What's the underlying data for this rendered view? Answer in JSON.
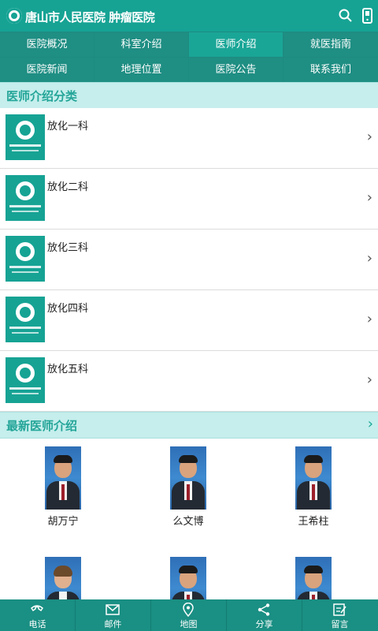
{
  "header": {
    "brand": "唐山市人民医院 肿瘤医院"
  },
  "icons": {
    "search": "search-icon",
    "phone": "mobile-phone-icon"
  },
  "nav": {
    "items": [
      {
        "label": "医院概况",
        "active": false
      },
      {
        "label": "科室介绍",
        "active": false
      },
      {
        "label": "医师介绍",
        "active": true
      },
      {
        "label": "就医指南",
        "active": false
      },
      {
        "label": "医院新闻",
        "active": false
      },
      {
        "label": "地理位置",
        "active": false
      },
      {
        "label": "医院公告",
        "active": false
      },
      {
        "label": "联系我们",
        "active": false
      }
    ]
  },
  "departments": {
    "title": "医师介绍分类",
    "items": [
      {
        "name": "放化一科"
      },
      {
        "name": "放化二科"
      },
      {
        "name": "放化三科"
      },
      {
        "name": "放化四科"
      },
      {
        "name": "放化五科"
      }
    ]
  },
  "doctors": {
    "title": "最新医师介绍",
    "items": [
      {
        "name": "胡万宁"
      },
      {
        "name": "么文博"
      },
      {
        "name": "王希柱"
      },
      {
        "name": ""
      },
      {
        "name": ""
      },
      {
        "name": ""
      }
    ]
  },
  "bottom_tabs": [
    {
      "label": "电话",
      "icon": "phone-icon"
    },
    {
      "label": "邮件",
      "icon": "mail-icon"
    },
    {
      "label": "地图",
      "icon": "map-pin-icon"
    },
    {
      "label": "分享",
      "icon": "share-icon"
    },
    {
      "label": "留言",
      "icon": "message-icon"
    }
  ],
  "colors": {
    "primary": "#16a394",
    "nav": "#1f8e83",
    "active": "#1aa697",
    "section_bg": "#c5eeec",
    "section_text": "#24a598"
  }
}
